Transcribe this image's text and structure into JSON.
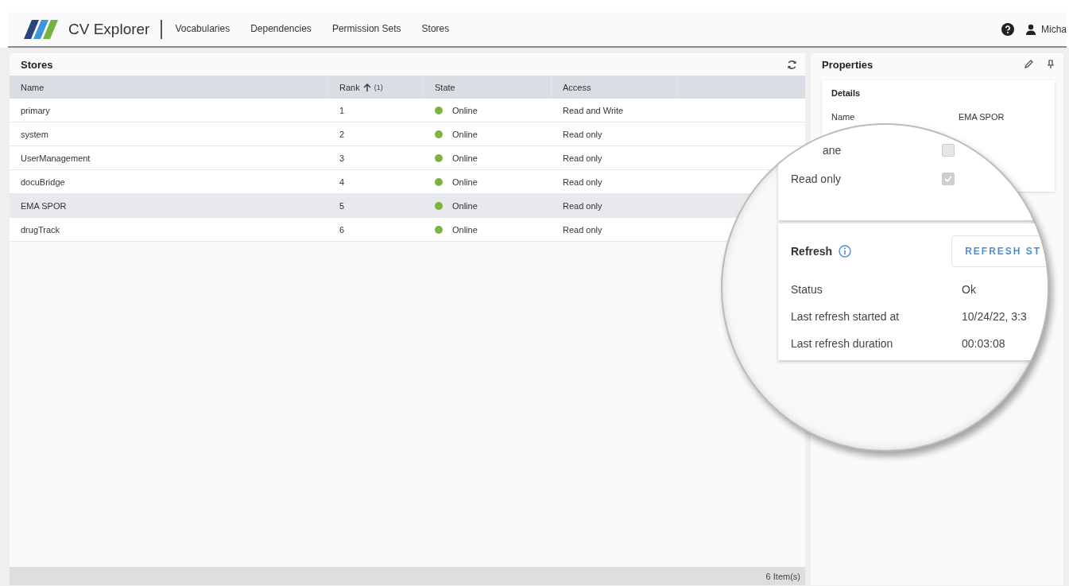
{
  "app": {
    "title": "CV Explorer",
    "nav": [
      {
        "label": "Vocabularies"
      },
      {
        "label": "Dependencies"
      },
      {
        "label": "Permission Sets"
      },
      {
        "label": "Stores"
      }
    ],
    "user": "Micha"
  },
  "stores": {
    "title": "Stores",
    "columns": [
      {
        "label": "Name"
      },
      {
        "label": "Rank",
        "sorted_ascending": true,
        "sort_index": "(1)"
      },
      {
        "label": "State"
      },
      {
        "label": "Access"
      }
    ],
    "rows": [
      {
        "name": "primary",
        "rank": "1",
        "state": "Online",
        "color": "#7cb342",
        "access": "Read and Write",
        "selected": false
      },
      {
        "name": "system",
        "rank": "2",
        "state": "Online",
        "color": "#7cb342",
        "access": "Read only",
        "selected": false
      },
      {
        "name": "UserManagement",
        "rank": "3",
        "state": "Online",
        "color": "#7cb342",
        "access": "Read only",
        "selected": false
      },
      {
        "name": "docuBridge",
        "rank": "4",
        "state": "Online",
        "color": "#7cb342",
        "access": "Read only",
        "selected": false
      },
      {
        "name": "EMA SPOR",
        "rank": "5",
        "state": "Online",
        "color": "#7cb342",
        "access": "Read only",
        "selected": true
      },
      {
        "name": "drugTrack",
        "rank": "6",
        "state": "Online",
        "color": "#7cb342",
        "access": "Read only",
        "selected": false
      }
    ],
    "footer": "6 Item(s)"
  },
  "properties": {
    "title": "Properties",
    "details": {
      "title": "Details",
      "name_label": "Name",
      "name_value": "EMA SPOR"
    }
  },
  "magnifier": {
    "details_rows": [
      {
        "label": "ane",
        "checked": false
      },
      {
        "label": "Read only",
        "checked": true
      }
    ],
    "refresh": {
      "title": "Refresh",
      "button": "REFRESH ST",
      "rows": [
        {
          "label": "Status",
          "value": "Ok"
        },
        {
          "label": "Last refresh started at",
          "value": "10/24/22, 3:3"
        },
        {
          "label": "Last refresh duration",
          "value": "00:03:08"
        }
      ]
    }
  }
}
